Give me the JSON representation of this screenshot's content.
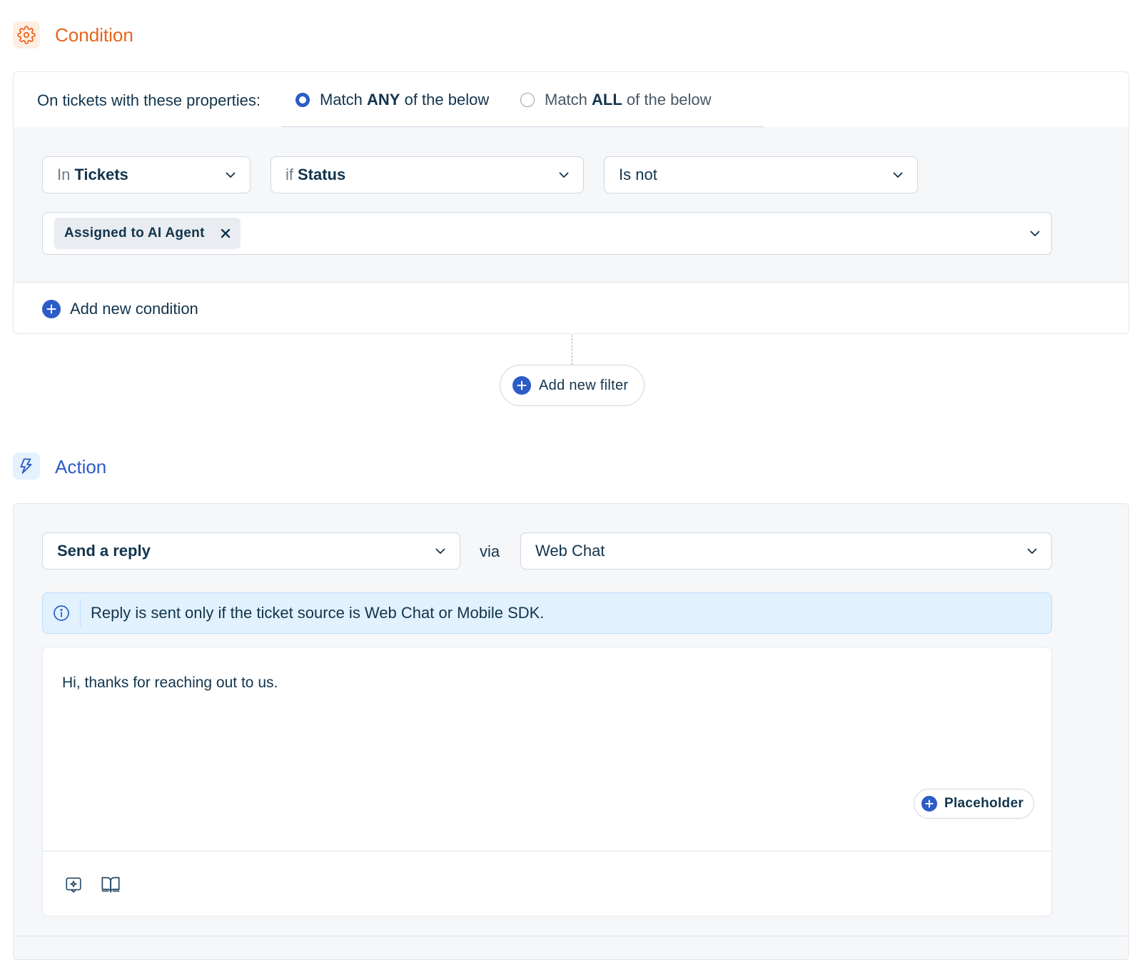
{
  "condition": {
    "title": "Condition",
    "icon": "gear-icon",
    "accent": "#e8641b",
    "properties_label": "On tickets with these properties:",
    "match_any": {
      "prefix": "Match ",
      "bold": "ANY",
      "suffix": " of the below",
      "selected": true
    },
    "match_all": {
      "prefix": "Match ",
      "bold": "ALL",
      "suffix": " of the below",
      "selected": false
    },
    "filter": {
      "source": {
        "prefix": "In",
        "value": "Tickets"
      },
      "field": {
        "prefix": "if",
        "value": "Status"
      },
      "operator": {
        "value": "Is not"
      },
      "values": [
        "Assigned to AI Agent"
      ]
    },
    "add_condition_label": "Add new condition",
    "add_filter_label": "Add new filter"
  },
  "action": {
    "title": "Action",
    "icon": "lightning-icon",
    "accent": "#2c5cc5",
    "action_type": "Send a reply",
    "via_label": "via",
    "channel": "Web Chat",
    "info_text": "Reply is sent only if the ticket source is Web Chat or Mobile SDK.",
    "reply_text": "Hi, thanks for reaching out to us.",
    "placeholder_button": "Placeholder",
    "toolbar_icons": [
      "ai-sparkle-icon",
      "book-icon"
    ]
  }
}
